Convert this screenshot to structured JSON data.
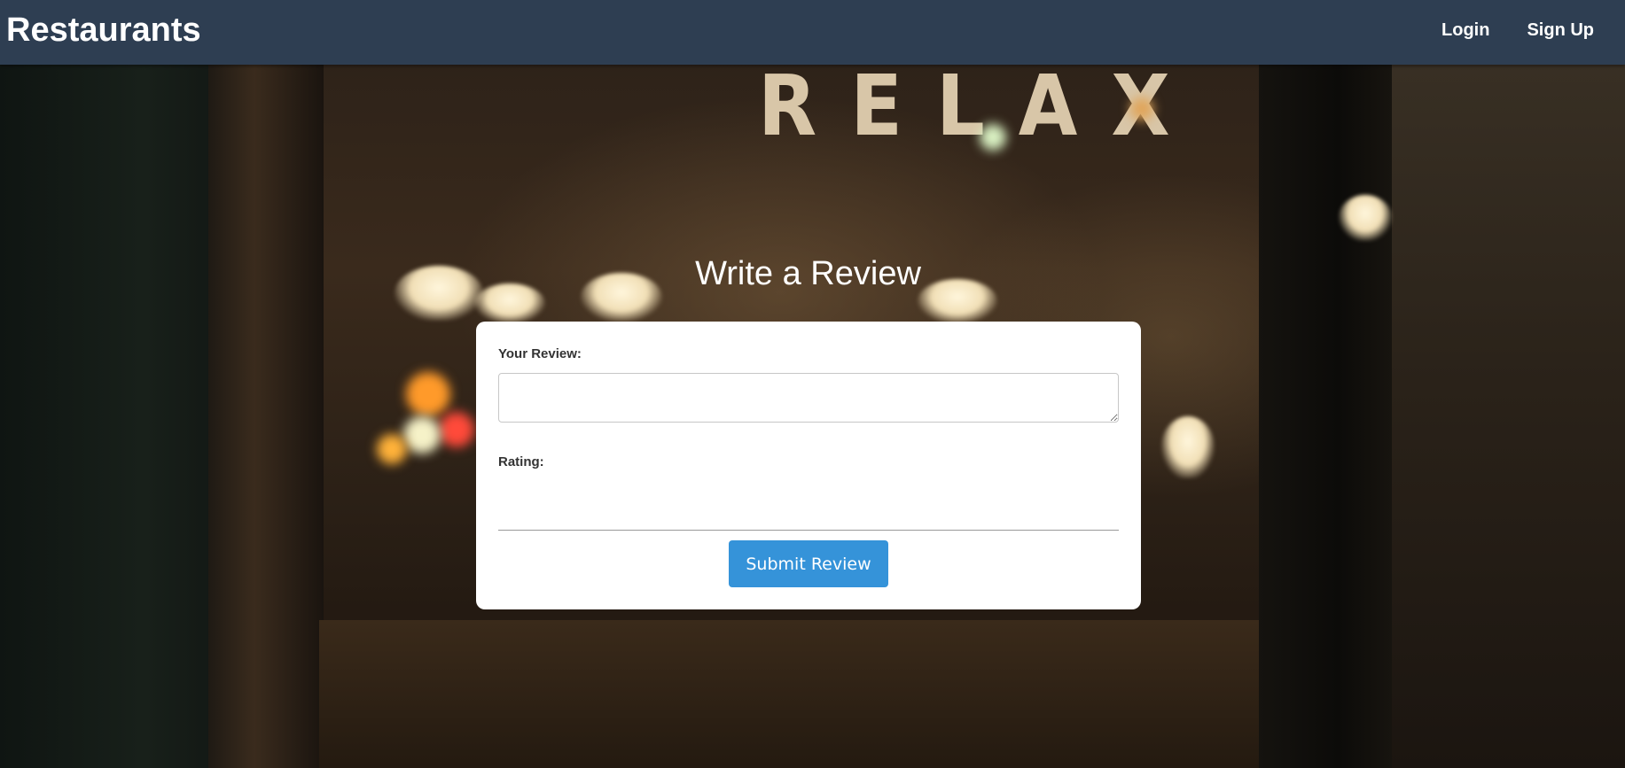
{
  "header": {
    "brand": "Restaurants",
    "nav": [
      {
        "label": "Login"
      },
      {
        "label": "Sign Up"
      }
    ],
    "background_color": "#2e3e52"
  },
  "background": {
    "sign_text": "RELAX"
  },
  "main": {
    "title": "Write a Review",
    "form": {
      "review_label": "Your Review:",
      "review_value": "",
      "rating_label": "Rating:",
      "rating_selected": "",
      "submit_label": "Submit Review",
      "submit_color": "#3593d9"
    }
  }
}
